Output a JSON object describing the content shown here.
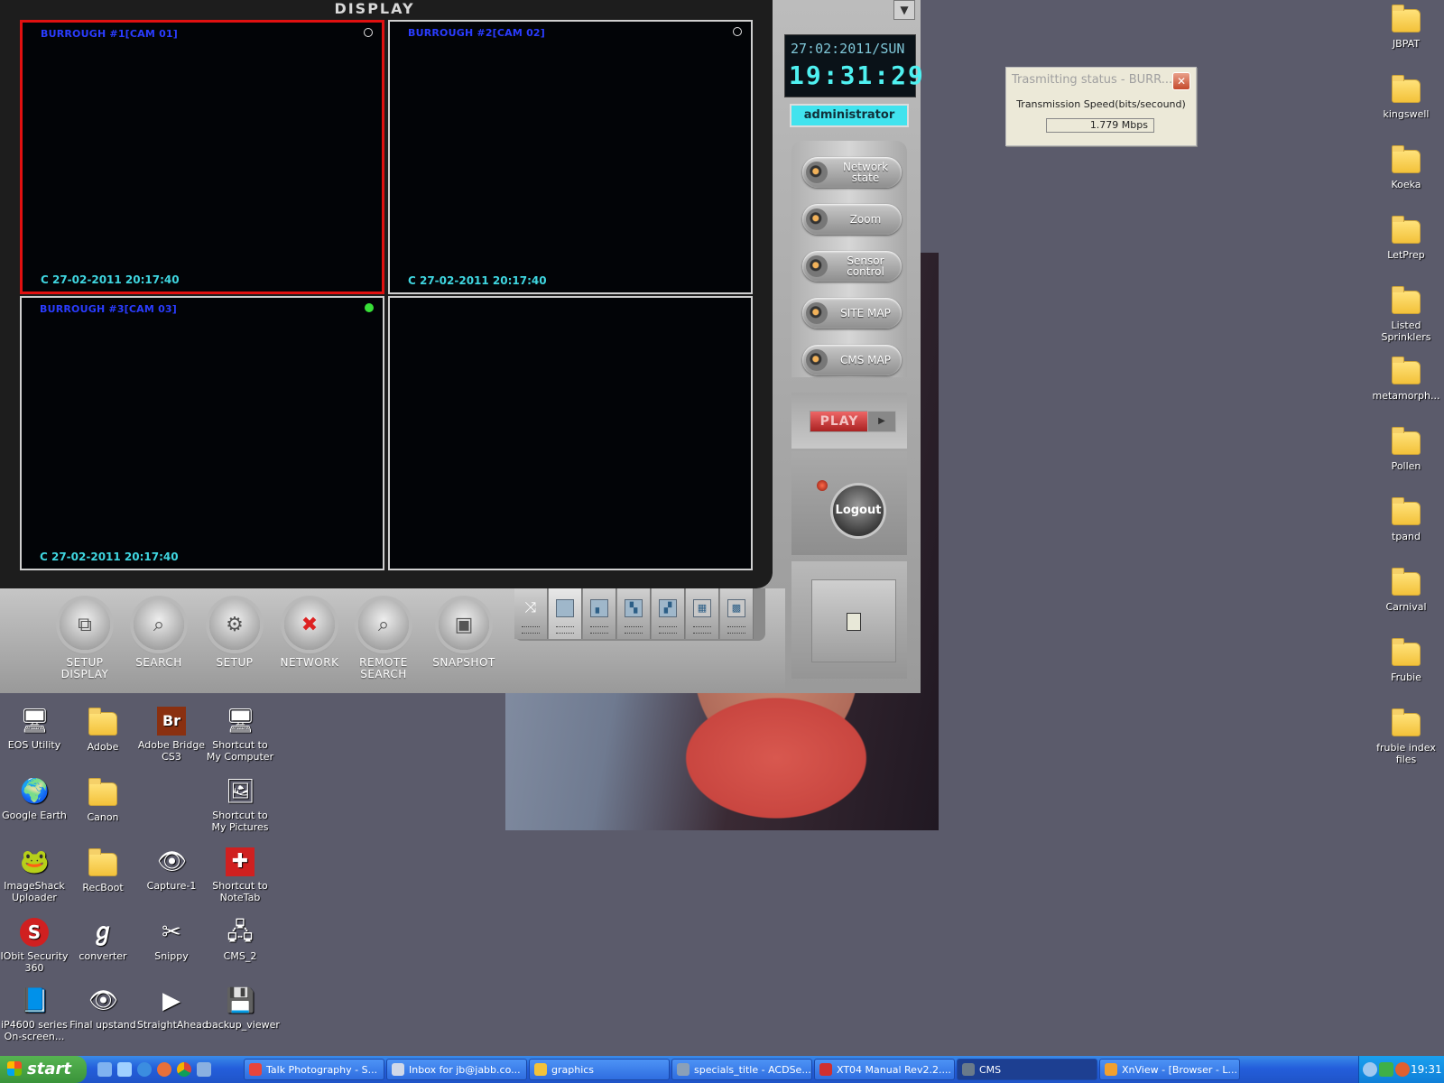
{
  "cms": {
    "display_title": "DISPLAY",
    "dropdown_glyph": "▼",
    "cameras": [
      {
        "title": "BURROUGH #1[CAM 01]",
        "timestamp": "C 27-02-2011 20:17:40",
        "selected": true,
        "status": "idle"
      },
      {
        "title": "BURROUGH #2[CAM 02]",
        "timestamp": "C 27-02-2011 20:17:40",
        "selected": false,
        "status": "idle"
      },
      {
        "title": "BURROUGH #3[CAM 03]",
        "timestamp": "C 27-02-2011 20:17:40",
        "selected": false,
        "status": "active"
      },
      {
        "title": "",
        "timestamp": "",
        "selected": false,
        "status": "none"
      }
    ],
    "clock": {
      "date": "27:02:2011/SUN",
      "time": "19:31:29"
    },
    "user": "administrator",
    "side_buttons": [
      {
        "label": "Network state",
        "icon": "knob-icon"
      },
      {
        "label": "Zoom",
        "icon": "knob-icon"
      },
      {
        "label": "Sensor control",
        "icon": "knob-icon"
      },
      {
        "label": "SITE MAP",
        "icon": "knob-icon"
      },
      {
        "label": "CMS MAP",
        "icon": "knob-icon"
      }
    ],
    "play_label": "PLAY",
    "logout_label": "Logout",
    "toolbar": [
      {
        "label": "SETUP DISPLAY",
        "icon": "setup-display-icon"
      },
      {
        "label": "SEARCH",
        "icon": "search-icon"
      },
      {
        "label": "SETUP",
        "icon": "setup-icon"
      },
      {
        "label": "NETWORK",
        "icon": "network-icon"
      },
      {
        "label": "REMOTE SEARCH",
        "icon": "remote-search-icon"
      },
      {
        "label": "SNAPSHOT",
        "icon": "snapshot-icon"
      }
    ],
    "layouts": [
      "shuffle",
      "1x1",
      "quad-a",
      "quad-b",
      "quad-c",
      "3x3",
      "4x4"
    ],
    "active_layout": "1x1"
  },
  "transmission": {
    "title": "Trasmitting status - BURR...",
    "label": "Transmission Speed(bits/secound)",
    "value": "1.779 Mbps"
  },
  "desktop_left": [
    {
      "label": "EOS Utility",
      "icon": "camera-icon"
    },
    {
      "label": "Adobe",
      "icon": "folder-icon"
    },
    {
      "label": "Adobe Bridge CS3",
      "icon": "adobe-bridge-icon"
    },
    {
      "label": "Shortcut to My Computer",
      "icon": "computer-icon"
    },
    {
      "label": "Google Earth",
      "icon": "globe-icon"
    },
    {
      "label": "Canon",
      "icon": "folder-icon"
    },
    {
      "label": "",
      "icon": ""
    },
    {
      "label": "Shortcut to My Pictures",
      "icon": "pictures-icon"
    },
    {
      "label": "ImageShack Uploader",
      "icon": "frog-icon"
    },
    {
      "label": "RecBoot",
      "icon": "folder-icon"
    },
    {
      "label": "Capture-1",
      "icon": "eye-icon"
    },
    {
      "label": "Shortcut to NoteTab",
      "icon": "notetab-icon"
    },
    {
      "label": "IObit Security 360",
      "icon": "shield-icon"
    },
    {
      "label": "converter",
      "icon": "converter-icon"
    },
    {
      "label": "Snippy",
      "icon": "scissors-icon"
    },
    {
      "label": "CMS_2",
      "icon": "cms-icon"
    },
    {
      "label": "iP4600 series On-screen...",
      "icon": "manual-icon"
    },
    {
      "label": "Final upstand",
      "icon": "tiff-icon"
    },
    {
      "label": "StraightAhead",
      "icon": "media-icon"
    },
    {
      "label": "backup_viewer",
      "icon": "disk-icon"
    }
  ],
  "desktop_right": [
    {
      "label": "JBPAT"
    },
    {
      "label": "kingswell"
    },
    {
      "label": "Koeka"
    },
    {
      "label": "LetPrep"
    },
    {
      "label": "Listed Sprinklers"
    },
    {
      "label": "metamorph..."
    },
    {
      "label": "Pollen"
    },
    {
      "label": "tpand"
    },
    {
      "label": "Carnival"
    },
    {
      "label": "Frubie"
    },
    {
      "label": "frubie index files"
    }
  ],
  "taskbar": {
    "start_label": "start",
    "tasks": [
      {
        "label": "Talk Photography - S...",
        "color": "#e8453c"
      },
      {
        "label": "Inbox for jb@jabb.co...",
        "color": "#d0d8e8"
      },
      {
        "label": "graphics",
        "color": "#f3c23a"
      },
      {
        "label": "specials_title - ACDSe...",
        "color": "#8aa0b8"
      },
      {
        "label": "XT04 Manual Rev2.2....",
        "color": "#d03030"
      },
      {
        "label": "CMS",
        "color": "#6a7a8a"
      },
      {
        "label": "XnView - [Browser - L...",
        "color": "#f0a030"
      }
    ],
    "active_task": "CMS",
    "clock": "19:31"
  }
}
